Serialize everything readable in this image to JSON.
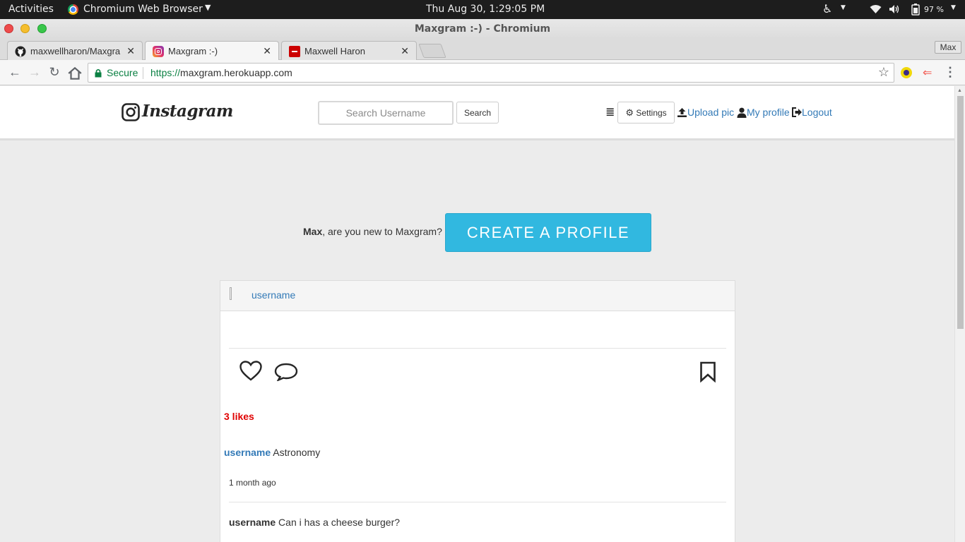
{
  "system": {
    "activities": "Activities",
    "app_menu": "Chromium Web Browser",
    "clock": "Thu Aug 30,  1:29:05 PM",
    "battery": "97 %"
  },
  "window": {
    "title": "Maxgram :-) - Chromium"
  },
  "tabs": [
    {
      "label": "maxwellharon/Maxgra",
      "favicon": "github-icon"
    },
    {
      "label": "Maxgram :-)",
      "favicon": "instagram-icon"
    },
    {
      "label": "Maxwell Haron",
      "favicon": "site-icon"
    }
  ],
  "profile_badge": "Max",
  "address_bar": {
    "secure_label": "Secure",
    "scheme": "https://",
    "host": "maxgram.herokuapp.com"
  },
  "navbar": {
    "brand": "Instagram",
    "search_placeholder": "Search Username",
    "search_button": "Search",
    "settings_button": "Settings",
    "upload_link": "Upload pic",
    "profile_link": "My profile",
    "logout_link": "Logout"
  },
  "cta": {
    "username": "Max",
    "question": ", are you new to Maxgram?",
    "button": "CREATE A PROFILE"
  },
  "post": {
    "author": "username",
    "likes": "3 likes",
    "caption_user": "username",
    "caption_text": "Astronomy",
    "timestamp": "1 month ago",
    "comments": [
      {
        "user": "username",
        "text": "Can i has a cheese burger?"
      }
    ]
  },
  "colors": {
    "link": "#337ab7",
    "cta": "#31b8e0",
    "likes": "#e00000",
    "secure": "#0b8043"
  }
}
